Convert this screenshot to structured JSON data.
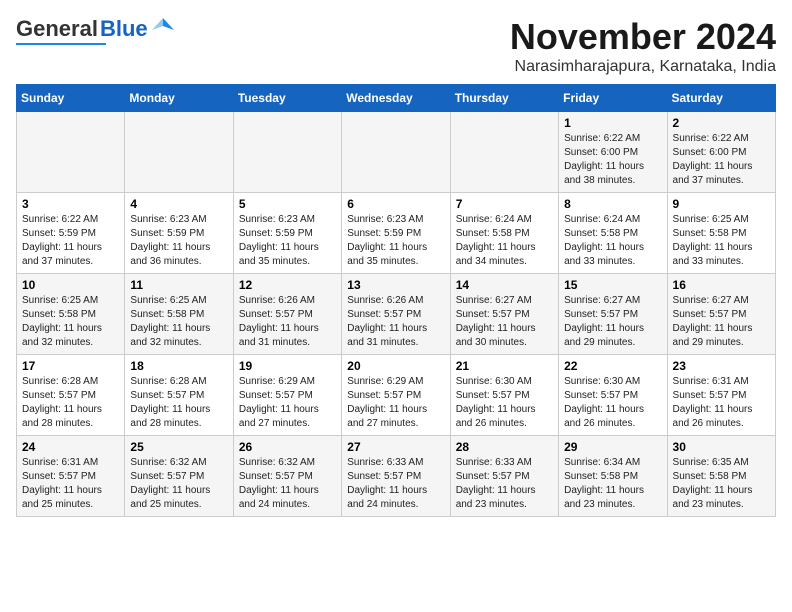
{
  "app": {
    "logo_general": "General",
    "logo_blue": "Blue"
  },
  "header": {
    "month": "November 2024",
    "location": "Narasimharajapura, Karnataka, India"
  },
  "weekdays": [
    "Sunday",
    "Monday",
    "Tuesday",
    "Wednesday",
    "Thursday",
    "Friday",
    "Saturday"
  ],
  "weeks": [
    {
      "days": [
        {
          "num": "",
          "info": ""
        },
        {
          "num": "",
          "info": ""
        },
        {
          "num": "",
          "info": ""
        },
        {
          "num": "",
          "info": ""
        },
        {
          "num": "",
          "info": ""
        },
        {
          "num": "1",
          "info": "Sunrise: 6:22 AM\nSunset: 6:00 PM\nDaylight: 11 hours\nand 38 minutes."
        },
        {
          "num": "2",
          "info": "Sunrise: 6:22 AM\nSunset: 6:00 PM\nDaylight: 11 hours\nand 37 minutes."
        }
      ]
    },
    {
      "days": [
        {
          "num": "3",
          "info": "Sunrise: 6:22 AM\nSunset: 5:59 PM\nDaylight: 11 hours\nand 37 minutes."
        },
        {
          "num": "4",
          "info": "Sunrise: 6:23 AM\nSunset: 5:59 PM\nDaylight: 11 hours\nand 36 minutes."
        },
        {
          "num": "5",
          "info": "Sunrise: 6:23 AM\nSunset: 5:59 PM\nDaylight: 11 hours\nand 35 minutes."
        },
        {
          "num": "6",
          "info": "Sunrise: 6:23 AM\nSunset: 5:59 PM\nDaylight: 11 hours\nand 35 minutes."
        },
        {
          "num": "7",
          "info": "Sunrise: 6:24 AM\nSunset: 5:58 PM\nDaylight: 11 hours\nand 34 minutes."
        },
        {
          "num": "8",
          "info": "Sunrise: 6:24 AM\nSunset: 5:58 PM\nDaylight: 11 hours\nand 33 minutes."
        },
        {
          "num": "9",
          "info": "Sunrise: 6:25 AM\nSunset: 5:58 PM\nDaylight: 11 hours\nand 33 minutes."
        }
      ]
    },
    {
      "days": [
        {
          "num": "10",
          "info": "Sunrise: 6:25 AM\nSunset: 5:58 PM\nDaylight: 11 hours\nand 32 minutes."
        },
        {
          "num": "11",
          "info": "Sunrise: 6:25 AM\nSunset: 5:58 PM\nDaylight: 11 hours\nand 32 minutes."
        },
        {
          "num": "12",
          "info": "Sunrise: 6:26 AM\nSunset: 5:57 PM\nDaylight: 11 hours\nand 31 minutes."
        },
        {
          "num": "13",
          "info": "Sunrise: 6:26 AM\nSunset: 5:57 PM\nDaylight: 11 hours\nand 31 minutes."
        },
        {
          "num": "14",
          "info": "Sunrise: 6:27 AM\nSunset: 5:57 PM\nDaylight: 11 hours\nand 30 minutes."
        },
        {
          "num": "15",
          "info": "Sunrise: 6:27 AM\nSunset: 5:57 PM\nDaylight: 11 hours\nand 29 minutes."
        },
        {
          "num": "16",
          "info": "Sunrise: 6:27 AM\nSunset: 5:57 PM\nDaylight: 11 hours\nand 29 minutes."
        }
      ]
    },
    {
      "days": [
        {
          "num": "17",
          "info": "Sunrise: 6:28 AM\nSunset: 5:57 PM\nDaylight: 11 hours\nand 28 minutes."
        },
        {
          "num": "18",
          "info": "Sunrise: 6:28 AM\nSunset: 5:57 PM\nDaylight: 11 hours\nand 28 minutes."
        },
        {
          "num": "19",
          "info": "Sunrise: 6:29 AM\nSunset: 5:57 PM\nDaylight: 11 hours\nand 27 minutes."
        },
        {
          "num": "20",
          "info": "Sunrise: 6:29 AM\nSunset: 5:57 PM\nDaylight: 11 hours\nand 27 minutes."
        },
        {
          "num": "21",
          "info": "Sunrise: 6:30 AM\nSunset: 5:57 PM\nDaylight: 11 hours\nand 26 minutes."
        },
        {
          "num": "22",
          "info": "Sunrise: 6:30 AM\nSunset: 5:57 PM\nDaylight: 11 hours\nand 26 minutes."
        },
        {
          "num": "23",
          "info": "Sunrise: 6:31 AM\nSunset: 5:57 PM\nDaylight: 11 hours\nand 26 minutes."
        }
      ]
    },
    {
      "days": [
        {
          "num": "24",
          "info": "Sunrise: 6:31 AM\nSunset: 5:57 PM\nDaylight: 11 hours\nand 25 minutes."
        },
        {
          "num": "25",
          "info": "Sunrise: 6:32 AM\nSunset: 5:57 PM\nDaylight: 11 hours\nand 25 minutes."
        },
        {
          "num": "26",
          "info": "Sunrise: 6:32 AM\nSunset: 5:57 PM\nDaylight: 11 hours\nand 24 minutes."
        },
        {
          "num": "27",
          "info": "Sunrise: 6:33 AM\nSunset: 5:57 PM\nDaylight: 11 hours\nand 24 minutes."
        },
        {
          "num": "28",
          "info": "Sunrise: 6:33 AM\nSunset: 5:57 PM\nDaylight: 11 hours\nand 23 minutes."
        },
        {
          "num": "29",
          "info": "Sunrise: 6:34 AM\nSunset: 5:58 PM\nDaylight: 11 hours\nand 23 minutes."
        },
        {
          "num": "30",
          "info": "Sunrise: 6:35 AM\nSunset: 5:58 PM\nDaylight: 11 hours\nand 23 minutes."
        }
      ]
    }
  ]
}
